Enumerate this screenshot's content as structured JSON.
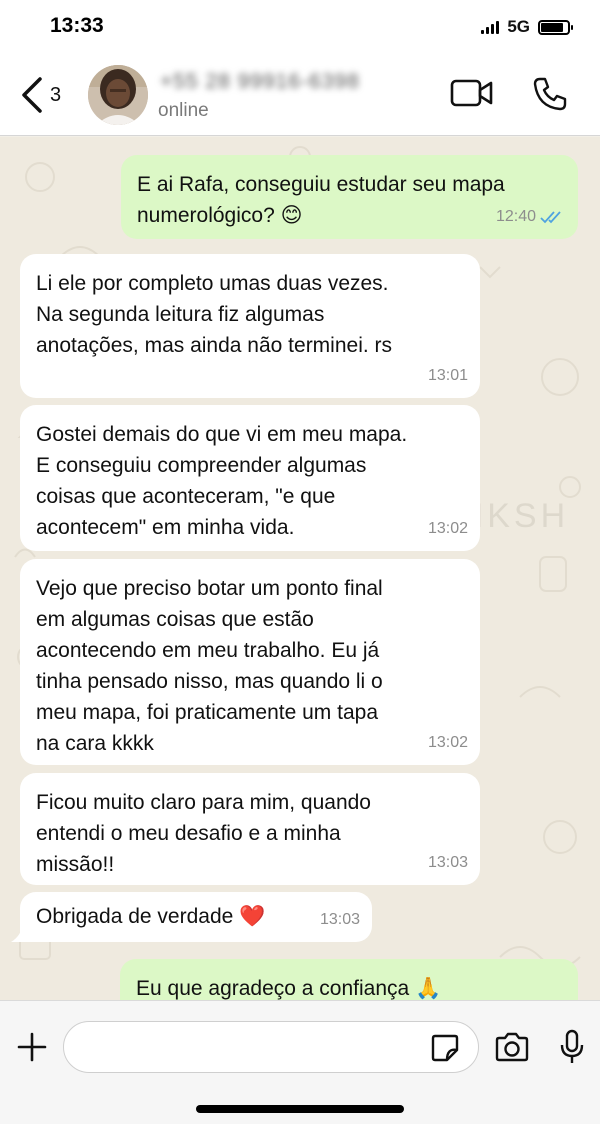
{
  "status_bar": {
    "time": "13:33",
    "network": "5G",
    "battery_level": 0.85
  },
  "header": {
    "back_count": "3",
    "contact_name": "+55 28 99916-6398",
    "contact_status": "online",
    "icons": {
      "back": "chevron-left-icon",
      "video": "video-camera-icon",
      "call": "phone-icon"
    }
  },
  "watermark": "PRINKSH",
  "messages": [
    {
      "direction": "out",
      "text": "E ai Rafa, conseguiu estudar seu mapa\nnumerológico? 😊",
      "time": "12:40",
      "read": true
    },
    {
      "direction": "in",
      "text": "Li ele por completo umas duas vezes.\nNa segunda leitura fiz algumas\nanotações, mas ainda não terminei. rs",
      "time": "13:01"
    },
    {
      "direction": "in",
      "text": "Gostei demais do que vi em meu mapa.\nE conseguiu compreender algumas\ncoisas que aconteceram, \"e que\nacontecem\" em minha vida.",
      "time": "13:02"
    },
    {
      "direction": "in",
      "text": "Vejo que preciso botar um ponto final\nem algumas coisas que estão\nacontecendo em meu trabalho. Eu já\ntinha pensado nisso, mas quando li o\nmeu mapa, foi praticamente um tapa\nna cara kkkk",
      "time": "13:02"
    },
    {
      "direction": "in",
      "text": "Ficou muito claro para mim, quando\nentendi o meu desafio e a minha\nmissão!!",
      "time": "13:03"
    },
    {
      "direction": "in",
      "text": "Obrigada de verdade ❤️",
      "time": "13:03"
    },
    {
      "direction": "out",
      "text": "Eu que agradeço a confiança 🙏",
      "time": ""
    }
  ],
  "input": {
    "value": "",
    "placeholder": ""
  },
  "colors": {
    "outgoing_bubble": "#dcf8c6",
    "incoming_bubble": "#ffffff",
    "read_ticks": "#4fa3e0",
    "wallpaper": "#efeadf"
  }
}
